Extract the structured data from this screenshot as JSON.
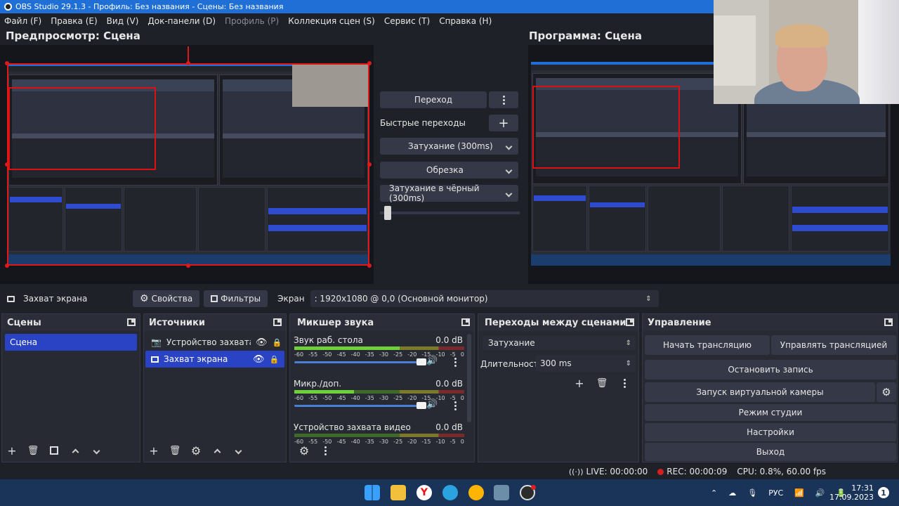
{
  "window": {
    "title": "OBS Studio 29.1.3 - Профиль: Без названия - Сцены: Без названия"
  },
  "menu": [
    {
      "label": "Файл (F)",
      "disabled": false
    },
    {
      "label": "Правка (E)",
      "disabled": false
    },
    {
      "label": "Вид (V)",
      "disabled": false
    },
    {
      "label": "Док-панели (D)",
      "disabled": false
    },
    {
      "label": "Профиль (P)",
      "disabled": true
    },
    {
      "label": "Коллекция сцен (S)",
      "disabled": false
    },
    {
      "label": "Сервис (T)",
      "disabled": false
    },
    {
      "label": "Справка (H)",
      "disabled": false
    }
  ],
  "preview": {
    "label": "Предпросмотр: Сцена"
  },
  "program": {
    "label": "Программа: Сцена"
  },
  "transitions_panel": {
    "transition_button": "Переход",
    "quick_transitions_label": "Быстрые переходы",
    "quick": [
      "Затухание (300ms)",
      "Обрезка",
      "Затухание в чёрный (300ms)"
    ],
    "tbar_level": 0.02
  },
  "source_bar": {
    "source_name": "Захват экрана",
    "properties": "Свойства",
    "filters": "Фильтры",
    "screen_label": "Экран",
    "screen_value": ": 1920x1080 @ 0,0 (Основной монитор)"
  },
  "scenes_dock": {
    "title": "Сцены",
    "items": [
      {
        "label": "Сцена",
        "selected": true
      }
    ]
  },
  "sources_dock": {
    "title": "Источники",
    "items": [
      {
        "label": "Устройство захвата ви",
        "selected": false
      },
      {
        "label": "Захват экрана",
        "selected": true
      }
    ]
  },
  "mixer_dock": {
    "title": "Микшер звука",
    "scale": [
      "-60",
      "-55",
      "-50",
      "-45",
      "-40",
      "-35",
      "-30",
      "-25",
      "-20",
      "-15",
      "-10",
      "-5",
      "0"
    ],
    "channels": [
      {
        "name": "Звук раб. стола",
        "db": "0.0 dB",
        "level": 0.62,
        "volume": 1.0
      },
      {
        "name": "Микр./доп.",
        "db": "0.0 dB",
        "level": 0.35,
        "volume": 1.0
      },
      {
        "name": "Устройство захвата видео",
        "db": "0.0 dB",
        "level": 0.0,
        "volume": 1.0
      }
    ]
  },
  "scene_transitions_dock": {
    "title": "Переходы между сценами",
    "selected": "Затухание",
    "duration_label": "Длительность",
    "duration_value": "300 ms"
  },
  "controls_dock": {
    "title": "Управление",
    "start_stream": "Начать трансляцию",
    "manage_stream": "Управлять трансляцией",
    "stop_record": "Остановить запись",
    "virtual_cam": "Запуск виртуальной камеры",
    "studio_mode": "Режим студии",
    "settings": "Настройки",
    "exit": "Выход"
  },
  "status": {
    "live": "LIVE: 00:00:00",
    "rec": "REC: 00:00:09",
    "cpu": "CPU: 0.8%, 60.00 fps"
  },
  "taskbar": {
    "lang": "РУС",
    "time": "17:31",
    "date": "17.09.2023"
  },
  "colors": {
    "accent": "#2a43c4",
    "background": "#1f2128",
    "panel": "#272a33",
    "titlebar": "#1f6fd6",
    "selection_frame": "#e01818",
    "rec": "#d42020"
  }
}
